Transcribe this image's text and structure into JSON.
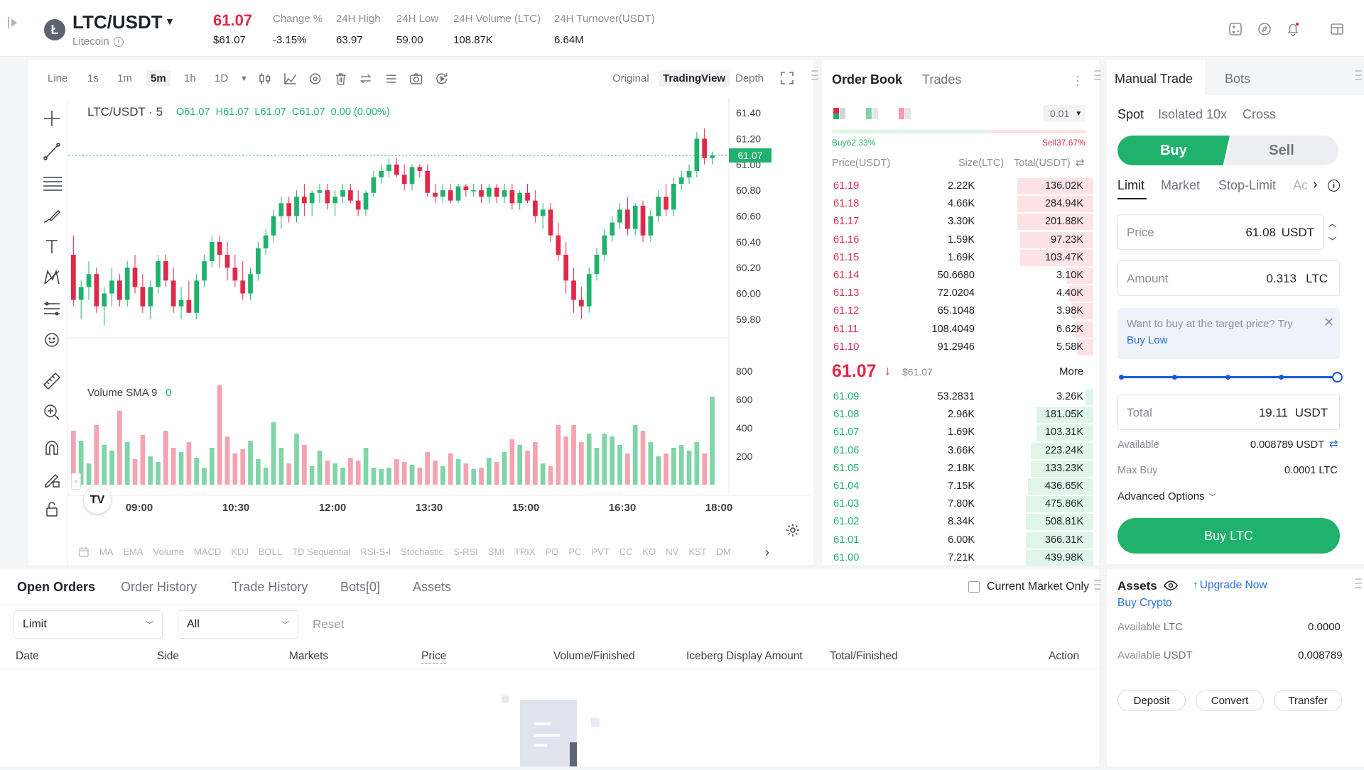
{
  "header": {
    "pair": "LTC/USDT",
    "coin": "Litecoin",
    "last_price": "61.07",
    "last_price_usd": "$61.07",
    "stats": [
      {
        "label": "Change %",
        "value": "-3.15%"
      },
      {
        "label": "24H High",
        "value": "63.97"
      },
      {
        "label": "24H Low",
        "value": "59.00"
      },
      {
        "label": "24H Volume (LTC)",
        "value": "108.87K"
      },
      {
        "label": "24H Turnover(USDT)",
        "value": "6.64M"
      }
    ]
  },
  "chart": {
    "intervals": [
      "Line",
      "1s",
      "1m",
      "5m",
      "1h",
      "1D"
    ],
    "active_interval": "5m",
    "views": [
      "Original",
      "TradingView",
      "Depth"
    ],
    "active_view": "TradingView",
    "legend_pair": "LTC/USDT · 5",
    "ohlc": "O61.07  H61.07  L61.07  C61.07  0.00 (0.00%)",
    "current_price_tag": "61.07",
    "price_ticks": [
      "61.40",
      "61.20",
      "61.00",
      "60.80",
      "60.60",
      "60.40",
      "60.20",
      "60.00",
      "59.80"
    ],
    "volume_label": "Volume SMA 9",
    "volume_value": "0",
    "volume_ticks": [
      "800",
      "600",
      "400",
      "200"
    ],
    "time_ticks": [
      "09:00",
      "10:30",
      "12:00",
      "13:30",
      "15:00",
      "16:30",
      "18:00"
    ],
    "indicators": [
      "MA",
      "EMA",
      "Volume",
      "MACD",
      "KDJ",
      "BOLL",
      "TD Sequential",
      "RSI-S-I",
      "Stochastic",
      "S-RSI",
      "SMI",
      "TRIX",
      "PO",
      "PC",
      "PVT",
      "CC",
      "KO",
      "NV",
      "KST",
      "DM"
    ],
    "logo": "TV"
  },
  "chart_data": {
    "type": "candlestick",
    "x_ticks": [
      "09:00",
      "10:30",
      "12:00",
      "13:30",
      "15:00",
      "16:30",
      "18:00"
    ],
    "ylim": [
      59.7,
      61.45
    ],
    "volume_ylim": [
      0,
      850
    ],
    "candles": [
      [
        60.3,
        60.45,
        59.9,
        59.95
      ],
      [
        59.95,
        60.1,
        59.8,
        60.05
      ],
      [
        60.05,
        60.25,
        59.95,
        60.15
      ],
      [
        60.15,
        60.2,
        59.85,
        59.9
      ],
      [
        59.9,
        60.05,
        59.75,
        60.0
      ],
      [
        60.0,
        60.2,
        59.9,
        60.1
      ],
      [
        60.1,
        60.15,
        59.9,
        59.95
      ],
      [
        59.95,
        60.25,
        59.9,
        60.2
      ],
      [
        60.2,
        60.3,
        60.0,
        60.05
      ],
      [
        60.05,
        60.15,
        59.85,
        59.9
      ],
      [
        59.9,
        60.1,
        59.8,
        60.05
      ],
      [
        60.05,
        60.3,
        60.0,
        60.25
      ],
      [
        60.25,
        60.3,
        60.05,
        60.1
      ],
      [
        60.1,
        60.2,
        59.85,
        59.9
      ],
      [
        59.9,
        60.05,
        59.8,
        59.95
      ],
      [
        59.95,
        60.1,
        59.85,
        59.85
      ],
      [
        59.85,
        60.15,
        59.8,
        60.1
      ],
      [
        60.1,
        60.3,
        60.05,
        60.25
      ],
      [
        60.25,
        60.45,
        60.2,
        60.4
      ],
      [
        60.4,
        60.45,
        60.2,
        60.3
      ],
      [
        60.3,
        60.4,
        60.1,
        60.2
      ],
      [
        60.2,
        60.3,
        60.05,
        60.1
      ],
      [
        60.1,
        60.25,
        59.95,
        60.0
      ],
      [
        60.0,
        60.2,
        59.95,
        60.15
      ],
      [
        60.15,
        60.4,
        60.1,
        60.35
      ],
      [
        60.35,
        60.5,
        60.3,
        60.45
      ],
      [
        60.45,
        60.65,
        60.4,
        60.6
      ],
      [
        60.6,
        60.75,
        60.5,
        60.7
      ],
      [
        60.7,
        60.75,
        60.55,
        60.6
      ],
      [
        60.6,
        60.8,
        60.55,
        60.75
      ],
      [
        60.75,
        60.85,
        60.6,
        60.7
      ],
      [
        60.7,
        60.8,
        60.6,
        60.78
      ],
      [
        60.78,
        60.85,
        60.7,
        60.8
      ],
      [
        60.8,
        60.85,
        60.65,
        60.7
      ],
      [
        60.7,
        60.8,
        60.6,
        60.75
      ],
      [
        60.75,
        60.85,
        60.7,
        60.8
      ],
      [
        60.8,
        60.85,
        60.7,
        60.72
      ],
      [
        60.72,
        60.8,
        60.6,
        60.65
      ],
      [
        60.65,
        60.8,
        60.6,
        60.78
      ],
      [
        60.78,
        60.95,
        60.75,
        60.9
      ],
      [
        60.9,
        61.0,
        60.85,
        60.95
      ],
      [
        60.95,
        61.05,
        60.9,
        61.0
      ],
      [
        61.0,
        61.05,
        60.9,
        60.92
      ],
      [
        60.92,
        61.0,
        60.8,
        60.85
      ],
      [
        60.85,
        61.0,
        60.8,
        60.98
      ],
      [
        60.98,
        61.0,
        60.9,
        60.95
      ],
      [
        60.95,
        61.0,
        60.75,
        60.78
      ],
      [
        60.78,
        60.85,
        60.7,
        60.75
      ],
      [
        60.75,
        60.85,
        60.7,
        60.8
      ],
      [
        60.8,
        60.85,
        60.7,
        60.72
      ],
      [
        60.72,
        60.85,
        60.7,
        60.83
      ],
      [
        60.83,
        60.85,
        60.75,
        60.8
      ],
      [
        60.8,
        60.85,
        60.75,
        60.8
      ],
      [
        60.8,
        60.85,
        60.7,
        60.75
      ],
      [
        60.75,
        60.85,
        60.7,
        60.82
      ],
      [
        60.82,
        60.85,
        60.7,
        60.75
      ],
      [
        60.75,
        60.85,
        60.7,
        60.8
      ],
      [
        60.8,
        60.85,
        60.65,
        60.7
      ],
      [
        60.7,
        60.8,
        60.65,
        60.78
      ],
      [
        60.78,
        60.85,
        60.7,
        60.72
      ],
      [
        60.72,
        60.8,
        60.55,
        60.6
      ],
      [
        60.6,
        60.7,
        60.5,
        60.65
      ],
      [
        60.65,
        60.7,
        60.4,
        60.45
      ],
      [
        60.45,
        60.55,
        60.25,
        60.3
      ],
      [
        60.3,
        60.4,
        60.0,
        60.1
      ],
      [
        60.1,
        60.2,
        59.85,
        59.95
      ],
      [
        59.95,
        60.05,
        59.8,
        59.9
      ],
      [
        59.9,
        60.2,
        59.85,
        60.15
      ],
      [
        60.15,
        60.35,
        60.1,
        60.3
      ],
      [
        60.3,
        60.5,
        60.25,
        60.45
      ],
      [
        60.45,
        60.6,
        60.4,
        60.55
      ],
      [
        60.55,
        60.7,
        60.5,
        60.65
      ],
      [
        60.65,
        60.75,
        60.45,
        60.5
      ],
      [
        60.5,
        60.7,
        60.45,
        60.68
      ],
      [
        60.68,
        60.72,
        60.4,
        60.45
      ],
      [
        60.45,
        60.65,
        60.4,
        60.6
      ],
      [
        60.6,
        60.8,
        60.55,
        60.75
      ],
      [
        60.75,
        60.85,
        60.6,
        60.65
      ],
      [
        60.65,
        60.9,
        60.6,
        60.85
      ],
      [
        60.85,
        60.95,
        60.8,
        60.9
      ],
      [
        60.9,
        61.0,
        60.85,
        60.95
      ],
      [
        60.95,
        61.25,
        60.9,
        61.2
      ],
      [
        61.2,
        61.28,
        61.0,
        61.05
      ],
      [
        61.05,
        61.1,
        61.0,
        61.07
      ]
    ],
    "volumes": [
      380,
      310,
      150,
      420,
      280,
      240,
      520,
      300,
      180,
      350,
      200,
      160,
      380,
      260,
      230,
      300,
      190,
      120,
      260,
      700,
      340,
      220,
      250,
      310,
      180,
      120,
      440,
      260,
      150,
      360,
      280,
      130,
      240,
      170,
      150,
      120,
      190,
      170,
      260,
      120,
      110,
      120,
      180,
      160,
      140,
      120,
      230,
      170,
      130,
      220,
      180,
      150,
      110,
      120,
      190,
      160,
      230,
      320,
      280,
      240,
      300,
      150,
      130,
      420,
      340,
      420,
      300,
      360,
      260,
      360,
      340,
      280,
      220,
      420,
      380,
      300,
      200,
      220,
      260,
      280,
      240,
      300,
      220,
      620
    ]
  },
  "orderbook": {
    "tabs": [
      "Order Book",
      "Trades"
    ],
    "active_tab": "Order Book",
    "precision": "0.01",
    "buy_pct": "Buy62.33%",
    "sell_pct": "Sell37.67%",
    "cols": [
      "Price(USDT)",
      "Size(LTC)",
      "Total(USDT)"
    ],
    "asks": [
      {
        "price": "61.19",
        "size": "2.22K",
        "total": "136.02K",
        "depth": 0.28
      },
      {
        "price": "61.18",
        "size": "4.66K",
        "total": "284.94K",
        "depth": 0.28
      },
      {
        "price": "61.17",
        "size": "3.30K",
        "total": "201.88K",
        "depth": 0.28
      },
      {
        "price": "61.16",
        "size": "1.59K",
        "total": "97.23K",
        "depth": 0.27
      },
      {
        "price": "61.15",
        "size": "1.69K",
        "total": "103.47K",
        "depth": 0.27
      },
      {
        "price": "61.14",
        "size": "50.6680",
        "total": "3.10K",
        "depth": 0.1
      },
      {
        "price": "61.13",
        "size": "72.0204",
        "total": "4.40K",
        "depth": 0.09
      },
      {
        "price": "61.12",
        "size": "65.1048",
        "total": "3.98K",
        "depth": 0.08
      },
      {
        "price": "61.11",
        "size": "108.4049",
        "total": "6.62K",
        "depth": 0.07
      },
      {
        "price": "61.10",
        "size": "91.2946",
        "total": "5.58K",
        "depth": 0.06
      }
    ],
    "mid_price": "61.07",
    "mid_usd": "$61.07",
    "more": "More",
    "bids": [
      {
        "price": "61.09",
        "size": "53.2831",
        "total": "3.26K",
        "depth": 0.03
      },
      {
        "price": "61.08",
        "size": "2.96K",
        "total": "181.05K",
        "depth": 0.21
      },
      {
        "price": "61.07",
        "size": "1.69K",
        "total": "103.31K",
        "depth": 0.21
      },
      {
        "price": "61.06",
        "size": "3.66K",
        "total": "223.24K",
        "depth": 0.23
      },
      {
        "price": "61.05",
        "size": "2.18K",
        "total": "133.23K",
        "depth": 0.23
      },
      {
        "price": "61.04",
        "size": "7.15K",
        "total": "436.65K",
        "depth": 0.24
      },
      {
        "price": "61.03",
        "size": "7.80K",
        "total": "475.86K",
        "depth": 0.25
      },
      {
        "price": "61.02",
        "size": "8.34K",
        "total": "508.81K",
        "depth": 0.25
      },
      {
        "price": "61.01",
        "size": "6.00K",
        "total": "366.31K",
        "depth": 0.25
      },
      {
        "price": "61.00",
        "size": "7.21K",
        "total": "439.98K",
        "depth": 0.25
      }
    ]
  },
  "trade": {
    "tabs": [
      "Manual Trade",
      "Bots"
    ],
    "modes": [
      "Spot",
      "Isolated 10x",
      "Cross"
    ],
    "buy": "Buy",
    "sell": "Sell",
    "order_types": [
      "Limit",
      "Market",
      "Stop-Limit",
      "Ac"
    ],
    "price_label": "Price",
    "price_value": "61.08",
    "price_unit": "USDT",
    "amount_label": "Amount",
    "amount_value": "0.313",
    "amount_unit": "LTC",
    "hint": "Want to buy at the target price? Try",
    "hint_link": "Buy Low",
    "slider_pct": 1.0,
    "total_label": "Total",
    "total_value": "19.11",
    "total_unit": "USDT",
    "available_label": "Available",
    "available_value": "0.008789 USDT",
    "maxbuy_label": "Max Buy",
    "maxbuy_value": "0.0001 LTC",
    "advanced": "Advanced Options",
    "submit": "Buy LTC"
  },
  "orders": {
    "tabs": [
      "Open Orders",
      "Order History",
      "Trade History",
      "Bots[0]",
      "Assets"
    ],
    "current_only": "Current Market Only",
    "filter_type": "Limit",
    "filter_side": "All",
    "reset": "Reset",
    "cols": [
      "Date",
      "Side",
      "Markets",
      "Price",
      "Volume/Finished",
      "Iceberg Display Amount",
      "Total/Finished",
      "Action"
    ]
  },
  "assets": {
    "title": "Assets",
    "upgrade": "Upgrade Now",
    "buy_crypto": "Buy Crypto",
    "rows": [
      {
        "label": "Available",
        "coin": "LTC",
        "value": "0.0000"
      },
      {
        "label": "Available",
        "coin": "USDT",
        "value": "0.008789"
      }
    ],
    "buttons": [
      "Deposit",
      "Convert",
      "Transfer"
    ]
  },
  "colors": {
    "up": "#20b26c",
    "down": "#e0294a",
    "up_bg": "#dff5ea",
    "down_bg": "#fde3e7"
  }
}
